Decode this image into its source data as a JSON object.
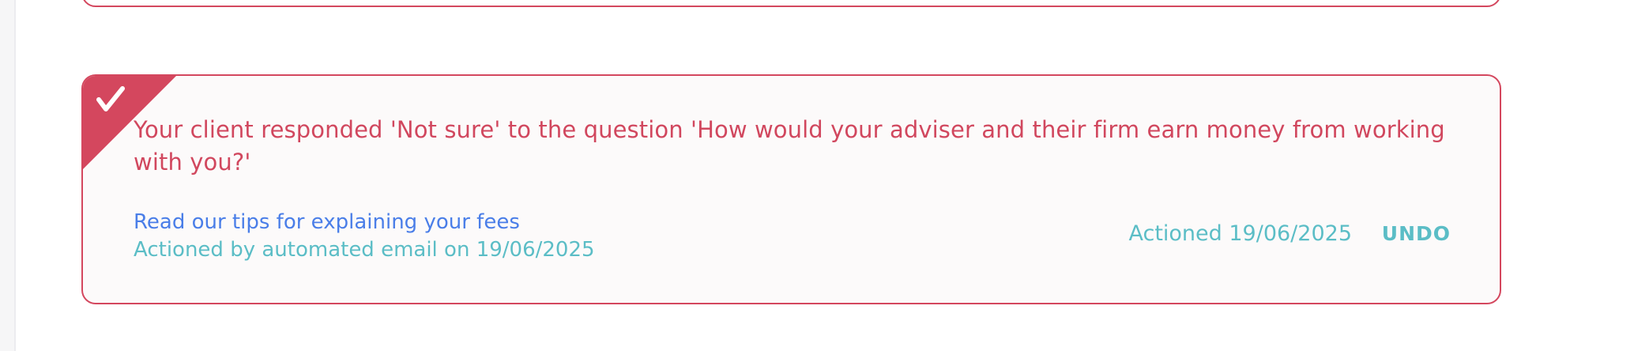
{
  "colors": {
    "accent_red": "#d4475e",
    "link_blue": "#4a7ee8",
    "teal": "#5bbdc6",
    "card_background": "#fcfafa"
  },
  "card": {
    "status_icon": "checkmark-icon",
    "message": "Your client responded 'Not sure' to the question 'How would your adviser and their firm earn money from working with you?'",
    "tips_link_label": "Read our tips for explaining your fees",
    "actioned_by_text": "Actioned by automated email on 19/06/2025",
    "actioned_date_text": "Actioned 19/06/2025",
    "undo_label": "UNDO"
  }
}
